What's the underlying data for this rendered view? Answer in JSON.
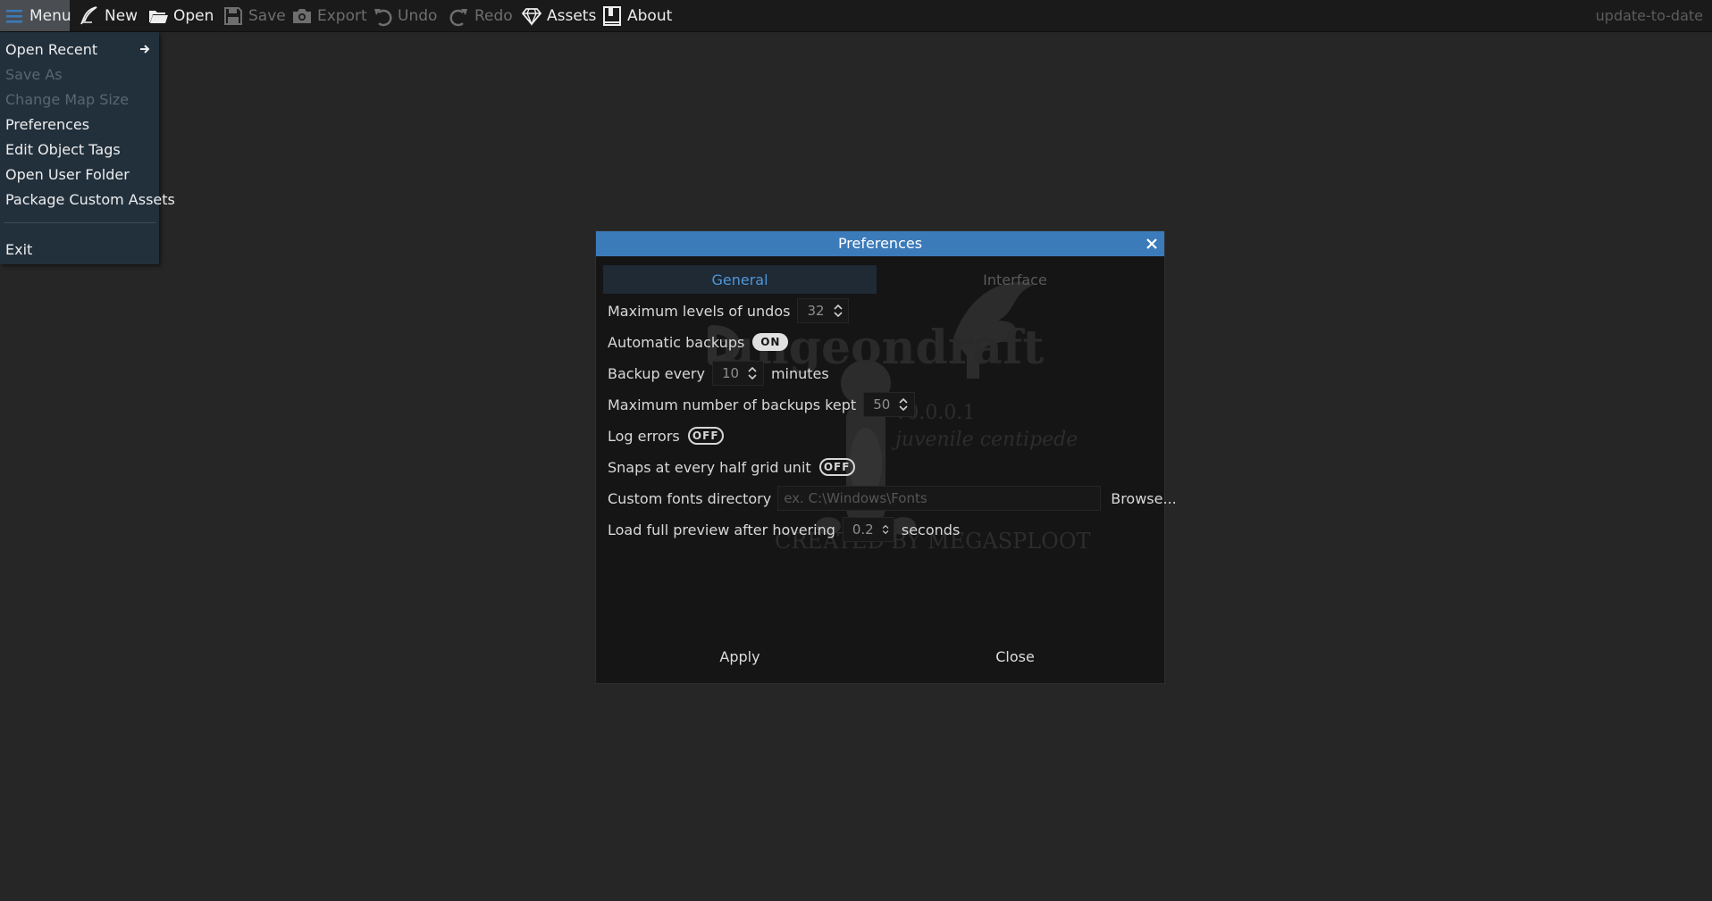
{
  "toolbar": {
    "menu": "Menu",
    "new": "New",
    "open": "Open",
    "save": "Save",
    "export": "Export",
    "undo": "Undo",
    "redo": "Redo",
    "assets": "Assets",
    "about": "About",
    "status": "update-to-date",
    "icons": [
      "hamburger-icon",
      "quill-icon",
      "folder-open-icon",
      "floppy-icon",
      "camera-icon",
      "undo-icon",
      "redo-icon",
      "gem-icon",
      "book-icon"
    ]
  },
  "menu": {
    "items": [
      {
        "label": "Open Recent",
        "enabled": true,
        "submenu": true
      },
      {
        "label": "Save As",
        "enabled": false
      },
      {
        "label": "Change Map Size",
        "enabled": false
      },
      {
        "label": "Preferences",
        "enabled": true
      },
      {
        "label": "Edit Object Tags",
        "enabled": true
      },
      {
        "label": "Open User Folder",
        "enabled": true
      },
      {
        "label": "Package Custom Assets",
        "enabled": true
      },
      {
        "label": "Exit",
        "enabled": true
      }
    ]
  },
  "dialog": {
    "title": "Preferences",
    "tabs": [
      {
        "label": "General",
        "active": true
      },
      {
        "label": "Interface",
        "active": false
      }
    ],
    "rows": {
      "undos": {
        "label": "Maximum levels of undos",
        "value": "32"
      },
      "auto_backups": {
        "label": "Automatic backups",
        "state": "ON"
      },
      "backup_every": {
        "label": "Backup every",
        "value": "10",
        "unit": "minutes"
      },
      "max_backups": {
        "label": "Maximum number of backups kept",
        "value": "50"
      },
      "log_errors": {
        "label": "Log errors",
        "state": "OFF"
      },
      "half_grid": {
        "label": "Snaps at every half grid unit",
        "state": "OFF"
      },
      "fonts_dir": {
        "label": "Custom fonts directory",
        "placeholder": "ex. C:\\Windows\\Fonts",
        "browse": "Browse..."
      },
      "preview": {
        "label": "Load full preview after hovering",
        "value": "0.2",
        "unit": "seconds"
      }
    },
    "apply": "Apply",
    "close": "Close"
  },
  "colors": {
    "background": "#262626",
    "toolbar": "#1a1a1a",
    "menu_bg": "#22303c",
    "dialog_title": "#3c7bba",
    "active_tab": "#4e97d8"
  }
}
